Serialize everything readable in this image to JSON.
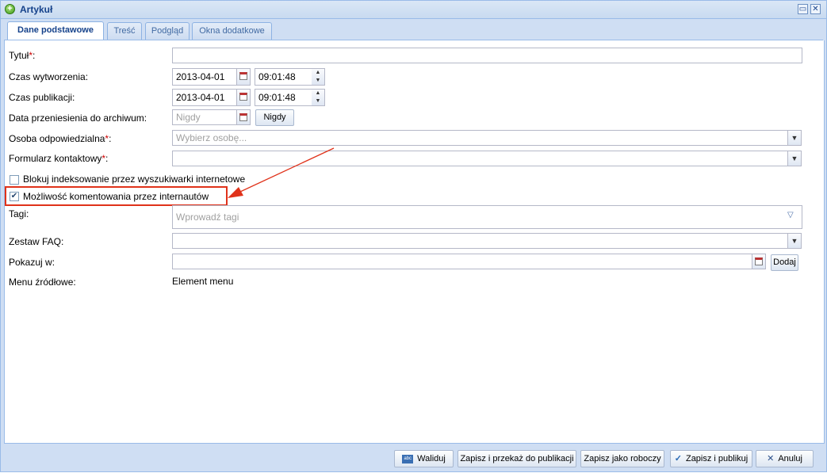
{
  "window": {
    "title": "Artykuł",
    "restore_glyph": "▭",
    "close_glyph": "✕"
  },
  "tabs": [
    {
      "label": "Dane podstawowe",
      "active": true
    },
    {
      "label": "Treść"
    },
    {
      "label": "Podgląd"
    },
    {
      "label": "Okna dodatkowe"
    }
  ],
  "form": {
    "tytul": {
      "label": "Tytuł",
      "required_mark": "*",
      "value": ""
    },
    "czas_wytworzenia": {
      "label": "Czas wytworzenia:",
      "date": "2013-04-01",
      "time": "09:01:48"
    },
    "czas_publikacji": {
      "label": "Czas publikacji:",
      "date": "2013-04-01",
      "time": "09:01:48"
    },
    "archiwum": {
      "label": "Data przeniesienia do archiwum:",
      "placeholder": "Nigdy",
      "button": "Nigdy"
    },
    "osoba": {
      "label": "Osoba odpowiedzialna",
      "required_mark": "*",
      "placeholder": "Wybierz osobę..."
    },
    "formularz": {
      "label": "Formularz kontaktowy",
      "required_mark": "*",
      "value": ""
    },
    "blokuj": {
      "label": "Blokuj indeksowanie przez wyszukiwarki internetowe",
      "checked": false
    },
    "komentowanie": {
      "label": "Możliwość komentowania przez internautów",
      "checked": true
    },
    "tagi": {
      "label": "Tagi:",
      "placeholder": "Wprowadź tagi"
    },
    "faq": {
      "label": "Zestaw FAQ:",
      "value": ""
    },
    "pokazuj": {
      "label": "Pokazuj w:",
      "value": "",
      "button": "Dodaj"
    },
    "menu": {
      "label": "Menu źródłowe:",
      "value": "Element menu"
    },
    "colon": ":"
  },
  "footer": {
    "waliduj": "Waliduj",
    "przekaz": "Zapisz i przekaż do publikacji",
    "roboczy": "Zapisz jako roboczy",
    "publikuj": "Zapisz i publikuj",
    "anuluj": "Anuluj",
    "waliduj_icon_text": "abc"
  },
  "colors": {
    "accent": "#15428b",
    "annotation": "#e0321a",
    "required": "#cc0000"
  }
}
